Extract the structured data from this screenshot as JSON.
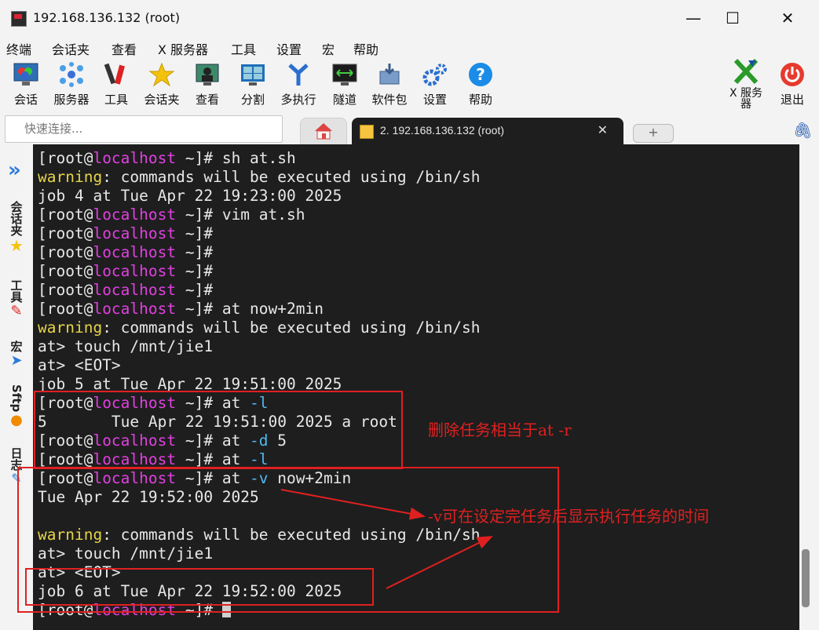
{
  "window": {
    "title": "192.168.136.132 (root)",
    "minimize": "—",
    "maximize": "☐",
    "close": "✕"
  },
  "menu": [
    "终端",
    "会话夹",
    "查看",
    "X 服务器",
    "工具",
    "设置",
    "宏",
    "帮助"
  ],
  "toolbar": {
    "items": [
      {
        "label": "会话",
        "icon": "session-icon"
      },
      {
        "label": "服务器",
        "icon": "servers-icon"
      },
      {
        "label": "工具",
        "icon": "tools-icon"
      },
      {
        "label": "会话夹",
        "icon": "star-icon"
      },
      {
        "label": "查看",
        "icon": "view-icon"
      },
      {
        "label": "分割",
        "icon": "split-icon"
      },
      {
        "label": "多执行",
        "icon": "multiexec-icon"
      },
      {
        "label": "隧道",
        "icon": "tunnel-icon"
      },
      {
        "label": "软件包",
        "icon": "packages-icon"
      },
      {
        "label": "设置",
        "icon": "settings-icon"
      },
      {
        "label": "帮助",
        "icon": "help-icon"
      }
    ],
    "xserver_label": "X 服务\n器",
    "exit_label": "退出"
  },
  "quick_connect": {
    "placeholder": "快速连接..."
  },
  "tabs": {
    "active_label": "2. 192.168.136.132 (root)",
    "new_tab": "+"
  },
  "sidebar": {
    "tabs": [
      {
        "label": "会话夹"
      },
      {
        "label": "工具"
      },
      {
        "label": "宏"
      },
      {
        "label": "Sftp"
      },
      {
        "label": "日志"
      }
    ]
  },
  "terminal": {
    "lines": [
      {
        "user": "[root@",
        "host": "localhost",
        "rest": " ~]# sh at.sh"
      },
      {
        "warn": "warning",
        "text": ": commands will be executed using /bin/sh"
      },
      {
        "text": "job 4 at Tue Apr 22 19:23:00 2025"
      },
      {
        "user": "[root@",
        "host": "localhost",
        "rest": " ~]# vim at.sh"
      },
      {
        "user": "[root@",
        "host": "localhost",
        "rest": " ~]#"
      },
      {
        "user": "[root@",
        "host": "localhost",
        "rest": " ~]#"
      },
      {
        "user": "[root@",
        "host": "localhost",
        "rest": " ~]#"
      },
      {
        "user": "[root@",
        "host": "localhost",
        "rest": " ~]#"
      },
      {
        "user": "[root@",
        "host": "localhost",
        "rest": " ~]# at now+2min"
      },
      {
        "warn": "warning",
        "text": ": commands will be executed using /bin/sh"
      },
      {
        "text": "at> touch /mnt/jie1"
      },
      {
        "text": "at> <EOT>"
      },
      {
        "text": "job 5 at Tue Apr 22 19:51:00 2025"
      },
      {
        "user": "[root@",
        "host": "localhost",
        "rest": " ~]# at ",
        "opt": "-l",
        "after": ""
      },
      {
        "text": "5       Tue Apr 22 19:51:00 2025 a root"
      },
      {
        "user": "[root@",
        "host": "localhost",
        "rest": " ~]# at ",
        "opt": "-d",
        "after": " 5"
      },
      {
        "user": "[root@",
        "host": "localhost",
        "rest": " ~]# at ",
        "opt": "-l",
        "after": ""
      },
      {
        "user": "[root@",
        "host": "localhost",
        "rest": " ~]# at ",
        "opt": "-v",
        "after": " now+2min"
      },
      {
        "text": "Tue Apr 22 19:52:00 2025"
      },
      {
        "text": ""
      },
      {
        "warn": "warning",
        "text": ": commands will be executed using /bin/sh"
      },
      {
        "text": "at> touch /mnt/jie1"
      },
      {
        "text": "at> <EOT>"
      },
      {
        "text": "job 6 at Tue Apr 22 19:52:00 2025"
      },
      {
        "user": "[root@",
        "host": "localhost",
        "rest": " ~]# ",
        "cursor": true
      }
    ]
  },
  "annotations": {
    "note1": "删除任务相当于at -r",
    "note2": "-v可在设定完任务后显示执行任务的时间"
  },
  "colors": {
    "terminal_bg": "#1e1e1e",
    "hostname": "#e040e0",
    "warning": "#e6d44a",
    "option": "#4fb8f0",
    "annotation": "#e02020"
  }
}
